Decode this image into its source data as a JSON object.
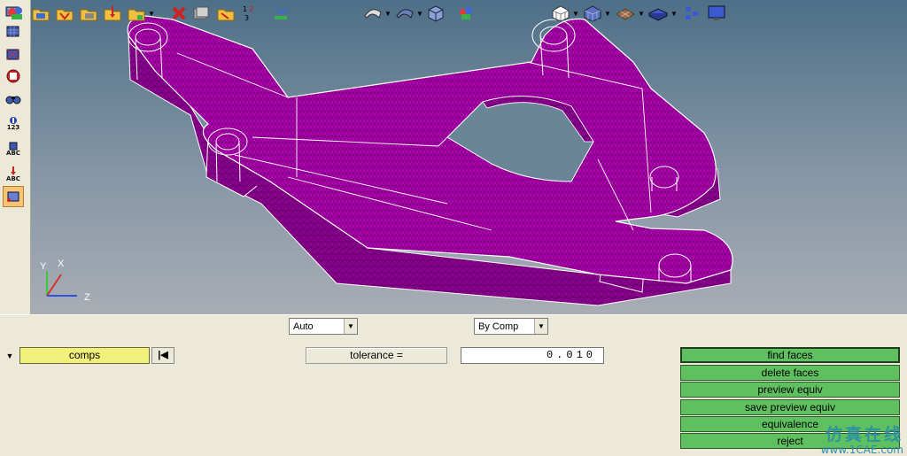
{
  "left_toolbar": {
    "labels": [
      "123",
      "ABC",
      "ABC"
    ]
  },
  "viewport": {
    "axes": {
      "y": "Y",
      "x": "X",
      "z": "Z"
    },
    "colors": {
      "mesh": "#b000b8",
      "edge": "#ffffff",
      "bg_top": "#4d6f87",
      "bg_bottom": "#a9adb4"
    }
  },
  "toolbar": {
    "display_mode": "Auto",
    "color_mode": "By Comp"
  },
  "panel": {
    "comps_label": "comps",
    "tolerance_label": "tolerance =",
    "tolerance_value": "0.010",
    "buttons": [
      {
        "label": "find faces"
      },
      {
        "label": "delete faces"
      },
      {
        "label": "preview equiv"
      },
      {
        "label": "save preview equiv"
      },
      {
        "label": "equivalence"
      },
      {
        "label": "reject"
      }
    ]
  },
  "watermark": {
    "cn": "仿真在线",
    "url": "www.1CAE.com"
  }
}
